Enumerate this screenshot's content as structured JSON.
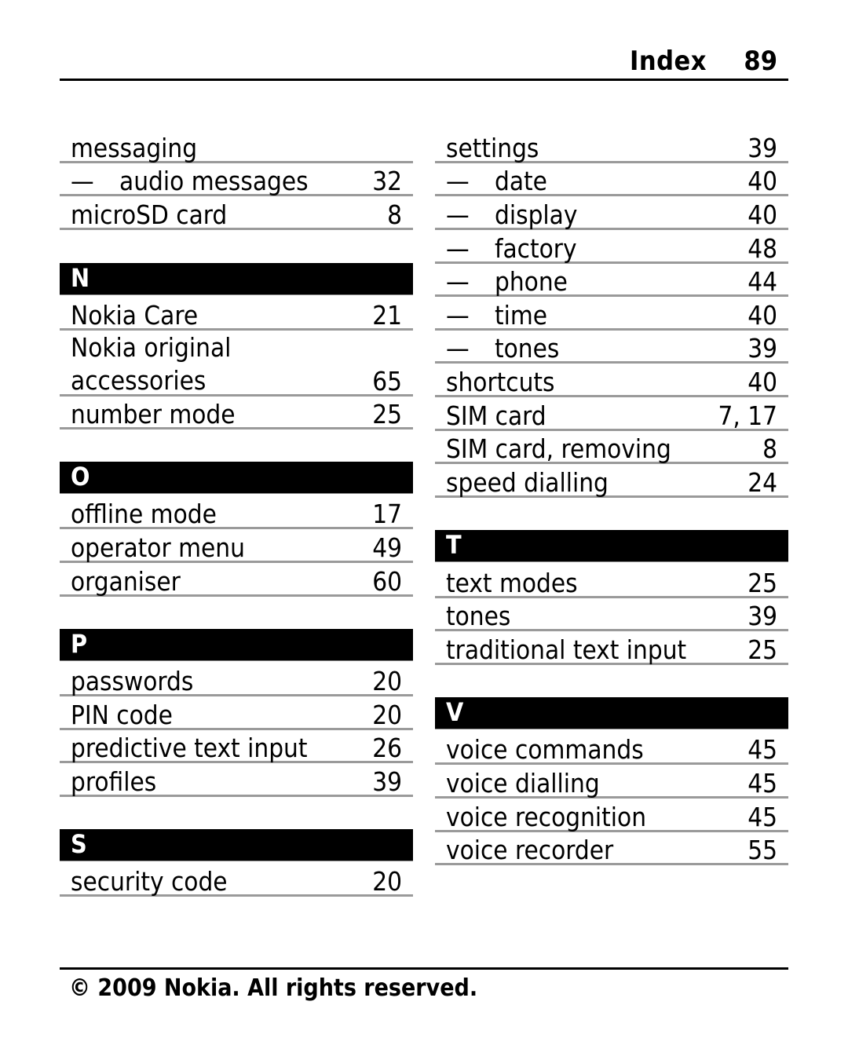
{
  "header": {
    "title": "Index",
    "page_number": "89"
  },
  "left_column": {
    "cont": [
      {
        "term": "messaging",
        "page": ""
      },
      {
        "term": "audio messages",
        "page": "32",
        "sub": true
      },
      {
        "term": "microSD card",
        "page": "8"
      }
    ],
    "sections": [
      {
        "letter": "N",
        "entries": [
          {
            "term": "Nokia Care",
            "page": "21"
          },
          {
            "term": "Nokia original",
            "term2": "accessories",
            "page": "65"
          },
          {
            "term": "number mode",
            "page": "25"
          }
        ]
      },
      {
        "letter": "O",
        "entries": [
          {
            "term": "offline mode",
            "page": "17"
          },
          {
            "term": "operator menu",
            "page": "49"
          },
          {
            "term": "organiser",
            "page": "60"
          }
        ]
      },
      {
        "letter": "P",
        "entries": [
          {
            "term": "passwords",
            "page": "20"
          },
          {
            "term": "PIN code",
            "page": "20"
          },
          {
            "term": "predictive text input",
            "page": "26"
          },
          {
            "term": "profiles",
            "page": "39"
          }
        ]
      },
      {
        "letter": "S",
        "entries": [
          {
            "term": "security code",
            "page": "20"
          }
        ]
      }
    ]
  },
  "right_column": {
    "cont": [
      {
        "term": "settings",
        "page": "39"
      },
      {
        "term": "date",
        "page": "40",
        "sub": true
      },
      {
        "term": "display",
        "page": "40",
        "sub": true
      },
      {
        "term": "factory",
        "page": "48",
        "sub": true
      },
      {
        "term": "phone",
        "page": "44",
        "sub": true
      },
      {
        "term": "time",
        "page": "40",
        "sub": true
      },
      {
        "term": "tones",
        "page": "39",
        "sub": true
      },
      {
        "term": "shortcuts",
        "page": "40"
      },
      {
        "term": "SIM card",
        "page": "7, 17"
      },
      {
        "term": "SIM card, removing",
        "page": "8"
      },
      {
        "term": "speed dialling",
        "page": "24"
      }
    ],
    "sections": [
      {
        "letter": "T",
        "entries": [
          {
            "term": "text modes",
            "page": "25"
          },
          {
            "term": "tones",
            "page": "39"
          },
          {
            "term": "traditional text input",
            "page": "25"
          }
        ]
      },
      {
        "letter": "V",
        "entries": [
          {
            "term": "voice commands",
            "page": "45"
          },
          {
            "term": "voice dialling",
            "page": "45"
          },
          {
            "term": "voice recognition",
            "page": "45"
          },
          {
            "term": "voice recorder",
            "page": "55"
          }
        ]
      }
    ]
  },
  "sub_marker": "—",
  "footer": {
    "copyright": "© 2009 Nokia. All rights reserved."
  }
}
